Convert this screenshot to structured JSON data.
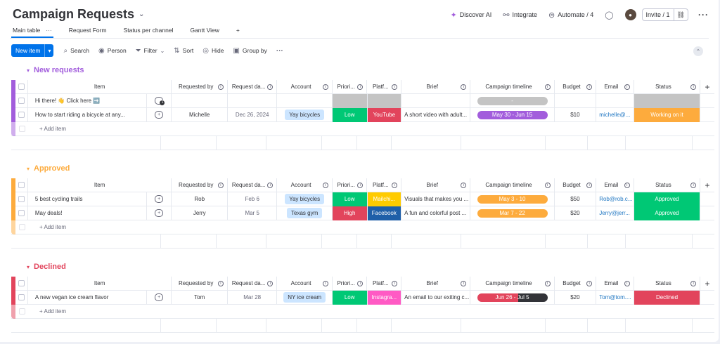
{
  "board": {
    "title": "Campaign Requests"
  },
  "header": {
    "discover": "Discover AI",
    "integrate": "Integrate",
    "automate": "Automate / 4",
    "invite": "Invite / 1"
  },
  "tabs": [
    {
      "label": "Main table"
    },
    {
      "label": "Request Form"
    },
    {
      "label": "Status per channel"
    },
    {
      "label": "Gantt View"
    },
    {
      "label": "+"
    }
  ],
  "toolbar": {
    "new_item": "New item",
    "search": "Search",
    "person": "Person",
    "filter": "Filter",
    "sort": "Sort",
    "hide": "Hide",
    "group_by": "Group by"
  },
  "columns": [
    "Item",
    "Requested by",
    "Request da...",
    "Account",
    "Priori...",
    "Platf...",
    "Brief",
    "Campaign timeline",
    "Budget",
    "Email",
    "Status"
  ],
  "add_item": "+ Add item",
  "colors": {
    "purple": "#a25ddc",
    "orange": "#fdab3d",
    "red": "#e2445c",
    "green": "#00c875",
    "blue": "#0073ea",
    "grey": "#c4c4c4"
  },
  "groups": [
    {
      "name": "New requests",
      "color": "#a25ddc",
      "rows": [
        {
          "item": "Hi there! 👋 Click here ➡️",
          "requested_by": "",
          "date": "",
          "account": "",
          "priority": "",
          "priority_color": "#c4c4c4",
          "platform": "",
          "platform_color": "#c4c4c4",
          "brief": "",
          "timeline": "-",
          "timeline_color": "#c4c4c4",
          "budget": "",
          "email": "",
          "status": "",
          "status_color": "#c4c4c4",
          "update_count": "1"
        },
        {
          "item": "How to start riding a bicycle at any...",
          "requested_by": "Michelle",
          "date": "Dec 26, 2024",
          "account": "Yay bicycles",
          "priority": "Low",
          "priority_color": "#00c875",
          "platform": "YouTube",
          "platform_color": "#e2445c",
          "brief": "A short video with adult...",
          "timeline": "May 30 - Jun 15",
          "timeline_color": "#a25ddc",
          "budget": "$10",
          "email": "michelle@...",
          "status": "Working on it",
          "status_color": "#fdab3d",
          "update_count": ""
        }
      ]
    },
    {
      "name": "Approved",
      "color": "#fdab3d",
      "rows": [
        {
          "item": "5 best cycling trails",
          "requested_by": "Rob",
          "date": "Feb 6",
          "account": "Yay bicycles",
          "priority": "Low",
          "priority_color": "#00c875",
          "platform": "Mailchi...",
          "platform_color": "#ffcb00",
          "brief": "Visuals that makes you ...",
          "timeline": "May 3 - 10",
          "timeline_color": "#fdab3d",
          "budget": "$50",
          "email": "Rob@rob.c...",
          "status": "Approved",
          "status_color": "#00c875",
          "update_count": ""
        },
        {
          "item": "May deals!",
          "requested_by": "Jerry",
          "date": "Mar 5",
          "account": "Texas gym",
          "priority": "High",
          "priority_color": "#e2445c",
          "platform": "Facebook",
          "platform_color": "#1f5fa8",
          "brief": "A fun and colorful post ...",
          "timeline": "Mar 7 - 22",
          "timeline_color": "#fdab3d",
          "budget": "$20",
          "email": "Jerry@jerr...",
          "status": "Approved",
          "status_color": "#00c875",
          "update_count": ""
        }
      ]
    },
    {
      "name": "Declined",
      "color": "#e2445c",
      "rows": [
        {
          "item": "A new vegan ice cream flavor",
          "requested_by": "Tom",
          "date": "Mar 28",
          "account": "NY ice cream",
          "priority": "Low",
          "priority_color": "#00c875",
          "platform": "Instagra...",
          "platform_color": "#ff5ac4",
          "brief": "An email to our exiting c...",
          "timeline": "Jun 26 - Jul 5",
          "timeline_color": "#e2445c",
          "budget": "$20",
          "email": "Tom@tom....",
          "status": "Declined",
          "status_color": "#e2445c",
          "update_count": ""
        }
      ]
    }
  ]
}
